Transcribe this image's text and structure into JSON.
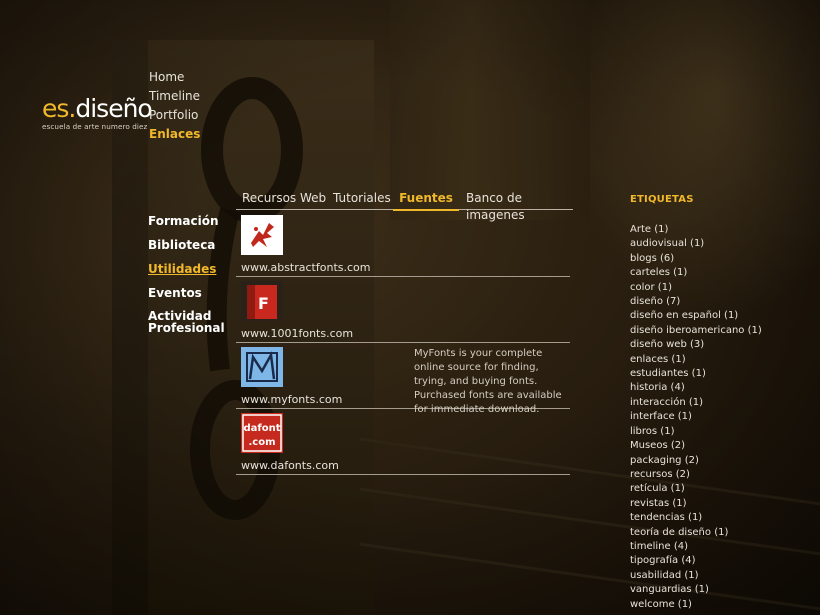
{
  "logo": {
    "prefix": "es.",
    "name": "diseño",
    "tagline": "escuela de arte numero diez"
  },
  "top_nav": [
    {
      "label": "Home",
      "active": false
    },
    {
      "label": "Timeline",
      "active": false
    },
    {
      "label": "Portfolio",
      "active": false
    },
    {
      "label": "Enlaces",
      "active": true
    }
  ],
  "side_nav": [
    {
      "label": "Formación"
    },
    {
      "label": "Biblioteca"
    },
    {
      "label": "Utilidades",
      "active": true
    },
    {
      "label": "Eventos"
    },
    {
      "label": "Actividad Profesional"
    }
  ],
  "tabs": [
    {
      "label": "Recursos Web"
    },
    {
      "label": "Tutoriales"
    },
    {
      "label": "Fuentes",
      "active": true
    },
    {
      "label": "Banco de imagenes"
    }
  ],
  "fonts": [
    {
      "link": "www.abstractfonts.com",
      "logo": "abstractfonts-logo-icon",
      "description": ""
    },
    {
      "link": "www.1001fonts.com",
      "logo": "1001fonts-logo-icon",
      "description": ""
    },
    {
      "link": "www.myfonts.com",
      "logo": "myfonts-logo-icon",
      "description": "MyFonts is your complete online source for finding, trying, and buying fonts. Purchased fonts are available for immediate download."
    },
    {
      "link": "www.dafonts.com",
      "logo": "dafont-logo-icon",
      "logo_text_1": "dafont",
      "logo_text_2": ".com",
      "description": ""
    }
  ],
  "tags": {
    "title": "ETIQUETAS",
    "items": [
      "Arte (1)",
      "audiovisual (1)",
      "blogs (6)",
      "carteles (1)",
      "color (1)",
      "diseño (7)",
      "diseño en español (1)",
      "diseño iberoamericano (1)",
      "diseño web (3)",
      "enlaces (1)",
      "estudiantes (1)",
      "historia (4)",
      "interacción (1)",
      "interface (1)",
      "libros (1)",
      "Museos (2)",
      "packaging (2)",
      "recursos (2)",
      "retícula (1)",
      "revistas (1)",
      "tendencias (1)",
      "teoría de diseño (1)",
      "timeline (4)",
      "tipografía (4)",
      "usabilidad (1)",
      "vanguardias (1)",
      "welcome (1)"
    ]
  },
  "colors": {
    "accent": "#f0b82a",
    "text": "#e8e3da"
  }
}
